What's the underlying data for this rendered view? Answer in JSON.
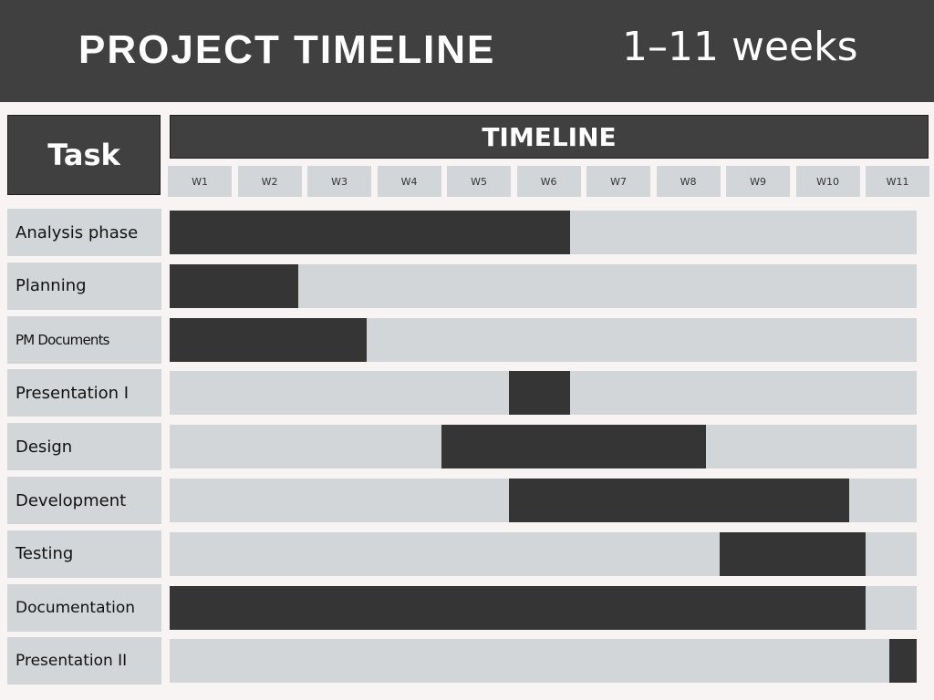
{
  "header": {
    "title": "PROJECT TIMELINE",
    "subtitle": "1–11 weeks"
  },
  "table": {
    "task_header": "Task",
    "timeline_header": "TIMELINE"
  },
  "colors": {
    "banner": "#404040",
    "bar": "#353535",
    "track": "#d3d6d9",
    "background": "#f7f4f3"
  },
  "chart_data": {
    "type": "bar",
    "orientation": "gantt",
    "weeks": [
      "W1",
      "W2",
      "W3",
      "W4",
      "W5",
      "W6",
      "W7",
      "W8",
      "W9",
      "W10",
      "W11"
    ],
    "xlim": [
      0,
      11
    ],
    "tasks": [
      {
        "label": "Analysis phase",
        "start": 0,
        "end": 5.9
      },
      {
        "label": "Planning",
        "start": 0,
        "end": 1.9
      },
      {
        "label": "PM Documents",
        "start": 0,
        "end": 2.9
      },
      {
        "label": "Presentation I",
        "start": 5.0,
        "end": 5.9
      },
      {
        "label": "Design",
        "start": 4.0,
        "end": 7.9
      },
      {
        "label": "Development",
        "start": 5.0,
        "end": 10.0
      },
      {
        "label": "Testing",
        "start": 8.1,
        "end": 10.25
      },
      {
        "label": "Documentation",
        "start": 0,
        "end": 10.25
      },
      {
        "label": "Presentation II",
        "start": 10.6,
        "end": 11.0
      }
    ]
  }
}
